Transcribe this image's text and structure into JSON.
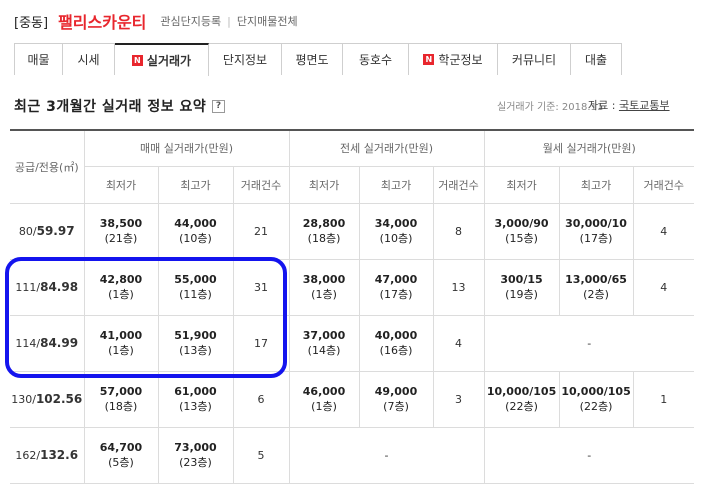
{
  "header": {
    "region": "[중동]",
    "complex_name": "팰리스카운티",
    "link_favorite": "관심단지등록",
    "link_all_listings": "단지매물전체"
  },
  "tabs": [
    {
      "label": "매물",
      "badge": ""
    },
    {
      "label": "시세",
      "badge": ""
    },
    {
      "label": "실거래가",
      "badge": "N",
      "active": true
    },
    {
      "label": "단지정보",
      "badge": ""
    },
    {
      "label": "평면도",
      "badge": ""
    },
    {
      "label": "동호수",
      "badge": ""
    },
    {
      "label": "학군정보",
      "badge": "N"
    },
    {
      "label": "커뮤니티",
      "badge": ""
    },
    {
      "label": "대출",
      "badge": ""
    }
  ],
  "section": {
    "title": "최근 3개월간 실거래 정보 요약",
    "help": "?",
    "basis": "실거래가 기준: 2018.11",
    "source_prefix": "자료 :",
    "source_name": "국토교통부"
  },
  "table": {
    "area_header": "공급/전용(㎡)",
    "groups": [
      "매매 실거래가(만원)",
      "전세 실거래가(만원)",
      "월세 실거래가(만원)"
    ],
    "subheaders": [
      "최저가",
      "최고가",
      "거래건수"
    ],
    "dash": "-",
    "rows": [
      {
        "supply": "80/",
        "exclusive": "59.97",
        "sale": {
          "min": "38,500",
          "min_floor": "(21층)",
          "max": "44,000",
          "max_floor": "(10층)",
          "count": "21"
        },
        "jeonse": {
          "min": "28,800",
          "min_floor": "(18층)",
          "max": "34,000",
          "max_floor": "(10층)",
          "count": "8"
        },
        "monthly": {
          "min": "3,000/90",
          "min_floor": "(15층)",
          "max": "30,000/10",
          "max_floor": "(17층)",
          "count": "4"
        }
      },
      {
        "supply": "111/",
        "exclusive": "84.98",
        "sale": {
          "min": "42,800",
          "min_floor": "(1층)",
          "max": "55,000",
          "max_floor": "(11층)",
          "count": "31"
        },
        "jeonse": {
          "min": "38,000",
          "min_floor": "(1층)",
          "max": "47,000",
          "max_floor": "(17층)",
          "count": "13"
        },
        "monthly": {
          "min": "300/15",
          "min_floor": "(19층)",
          "max": "13,000/65",
          "max_floor": "(2층)",
          "count": "4"
        }
      },
      {
        "supply": "114/",
        "exclusive": "84.99",
        "sale": {
          "min": "41,000",
          "min_floor": "(1층)",
          "max": "51,900",
          "max_floor": "(13층)",
          "count": "17"
        },
        "jeonse": {
          "min": "37,000",
          "min_floor": "(14층)",
          "max": "40,000",
          "max_floor": "(16층)",
          "count": "4"
        },
        "monthly": null
      },
      {
        "supply": "130/",
        "exclusive": "102.56",
        "sale": {
          "min": "57,000",
          "min_floor": "(18층)",
          "max": "61,000",
          "max_floor": "(13층)",
          "count": "6"
        },
        "jeonse": {
          "min": "46,000",
          "min_floor": "(1층)",
          "max": "49,000",
          "max_floor": "(7층)",
          "count": "3"
        },
        "monthly": {
          "min": "10,000/105",
          "min_floor": "(22층)",
          "max": "10,000/105",
          "max_floor": "(22층)",
          "count": "1"
        }
      },
      {
        "supply": "162/",
        "exclusive": "132.6",
        "sale": {
          "min": "64,700",
          "min_floor": "(5층)",
          "max": "73,000",
          "max_floor": "(23층)",
          "count": "5"
        },
        "jeonse": null,
        "monthly": null
      }
    ]
  },
  "annotation": {
    "color": "#1414ee"
  },
  "colors": {
    "accent": "#e8262d"
  }
}
